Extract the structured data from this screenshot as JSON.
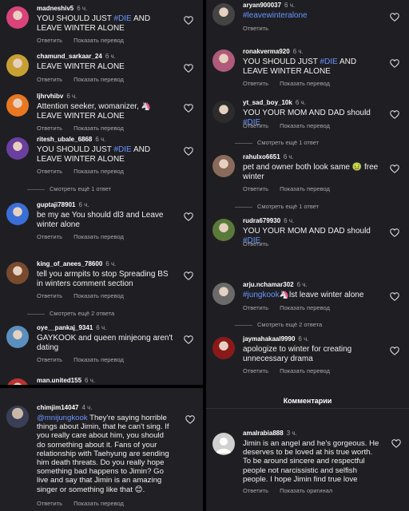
{
  "left_top": {
    "comments": [
      {
        "user": "madneshiv5",
        "time": "6 ч.",
        "pre": "YOU SHOULD JUST ",
        "tag": "#DIE",
        "post": " AND LEAVE WINTER ALONE",
        "reply": "Ответить",
        "translate": "Показать перевод",
        "avatar_color": "#d9437a"
      },
      {
        "user": "chamund_sarkaar_24",
        "time": "6 ч.",
        "pre": "LEAVE WINTER ALONE",
        "tag": "",
        "post": "",
        "reply": "Ответить",
        "translate": "Показать перевод",
        "avatar_color": "#c7a033"
      },
      {
        "user": "ljhrvhibv",
        "time": "6 ч.",
        "pre": "Attention seeker, womanizer, 🦄 LEAVE WINTER ALONE",
        "tag": "",
        "post": "",
        "reply": "Ответить",
        "translate": "Показать перевод",
        "avatar_color": "#e87722"
      },
      {
        "user": "ritesh_ubale_6868",
        "time": "6 ч.",
        "pre": "YOU SHOULD JUST ",
        "tag": "#DIE",
        "post": " AND LEAVE WINTER ALONE",
        "reply": "Ответить",
        "translate": "Показать перевод",
        "avatar_color": "#6b3fa0",
        "more": "Смотреть ещё 1 ответ"
      },
      {
        "user": "guptaji78901",
        "time": "6 ч.",
        "pre": "be my ae You should dl3 and Leave winter alone",
        "tag": "",
        "post": "",
        "reply": "Ответить",
        "translate": "Показать перевод",
        "avatar_color": "#3a6fd8"
      },
      {
        "user": "king_of_anees_78600",
        "time": "6 ч.",
        "pre": "tell you armpits to stop Spreading BS in winters comment section",
        "tag": "",
        "post": "",
        "reply": "Ответить",
        "translate": "Показать перевод",
        "avatar_color": "#7a4a2e",
        "more": "Смотреть ещё 2 ответа"
      },
      {
        "user": "oye__pankaj_9341",
        "time": "6 ч.",
        "pre": "GAYKOOK and queen minjeong aren't dating",
        "tag": "",
        "post": "",
        "reply": "Ответить",
        "translate": "Показать перевод",
        "avatar_color": "#5b8fbf"
      },
      {
        "user": "man.united155",
        "time": "6 ч.",
        "pre": "",
        "tag": "",
        "post": "",
        "reply": "",
        "translate": "",
        "avatar_color": "#b33"
      }
    ]
  },
  "left_bottom": {
    "user": "chimjim14047",
    "time": "4 ч.",
    "mention": "@mnijungkook",
    "text": " They're saying horrible things about Jimin, that he can't sing. If you really care about him, you should do something about it. Fans of your relationship with Taehyung are sending him death threats. Do you really hope something bad happens to Jimin? Go live and say that Jimin is an amazing singer or something like that 😊.",
    "reply": "Ответить",
    "translate": "Показать перевод",
    "avatar_color": "#3a3f55"
  },
  "right": {
    "comments": [
      {
        "user": "aryan900037",
        "time": "6 ч.",
        "pre": "",
        "tag": "#leavewinteralone",
        "post": "",
        "reply": "Ответить",
        "translate": "",
        "avatar_color": "#444"
      },
      {
        "user": "ronakverma920",
        "time": "6 ч.",
        "pre": "YOU SHOULD JUST ",
        "tag": "#DIE",
        "post": " AND LEAVE WINTER ALONE",
        "reply": "Ответить",
        "translate": "Показать перевод",
        "avatar_color": "#b05a7a"
      },
      {
        "user": "yt_sad_boy_10k",
        "time": "6 ч.",
        "pre": "YOU YOUR MOM AND DAD should ",
        "tag": "#DIE",
        "post": "",
        "reply": "Ответить",
        "translate": "Показать перевод",
        "avatar_color": "#2c2c2c",
        "more": "Смотреть ещё 1 ответ"
      },
      {
        "user": "rahulxo6651",
        "time": "6 ч.",
        "pre": "pet and owner both look same 🤢 free winter",
        "tag": "",
        "post": "",
        "reply": "Ответить",
        "translate": "Показать перевод",
        "avatar_color": "#8a6a5a",
        "more": "Смотреть ещё 1 ответ"
      },
      {
        "user": "rudra679930",
        "time": "6 ч.",
        "pre": "YOU YOUR MOM AND DAD should ",
        "tag": "#DIE",
        "post": "",
        "reply": "Ответить",
        "translate": "",
        "avatar_color": "#5a7a3a"
      },
      {
        "user": "arju.nchamar302",
        "time": "6 ч.",
        "pre": "",
        "tag": "#jungkook",
        "post": "🦄lst leave winter alone",
        "reply": "Ответить",
        "translate": "Показать перевод",
        "avatar_color": "#6a6a6a",
        "more": "Смотреть ещё 2 ответа"
      },
      {
        "user": "jaymahakaal9990",
        "time": "6 ч.",
        "pre": "apologize to winter for creating unnecessary drama",
        "tag": "",
        "post": "",
        "reply": "Ответить",
        "translate": "Показать перевод",
        "avatar_color": "#8a1a1a"
      }
    ],
    "sheet_title": "Комментарии",
    "bottom_comment": {
      "user": "amalrabia888",
      "time": "3 ч.",
      "text": "Jimin is an angel and he's gorgeous. He deserves to be loved at his true worth. To be around sincere and respectful people not narcissistic and selfish people. I hope Jimin find true love",
      "reply": "Ответить",
      "translate": "Показать оригинал",
      "avatar_color": "#d0d0d0"
    }
  },
  "icons": {
    "like": "heart-outline-icon"
  },
  "colors": {
    "hashtag": "#6a94ff",
    "background": "#1f1f23"
  }
}
